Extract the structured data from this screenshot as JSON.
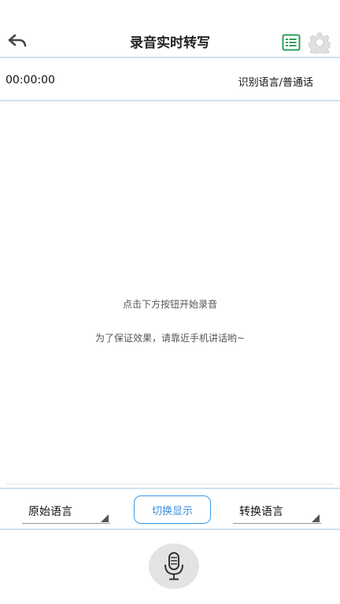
{
  "header": {
    "title": "录音实时转写",
    "back_icon": "back-arrow-icon",
    "list_icon": "list-icon",
    "settings_icon": "gear-icon"
  },
  "status": {
    "timer": "00:00:00",
    "recognition_language": "识别语言/普通话"
  },
  "main": {
    "hint_line1": "点击下方按钮开始录音",
    "hint_line2": "为了保证效果，请靠近手机讲话哟~"
  },
  "language_bar": {
    "source_language": "原始语言",
    "switch_display": "切换显示",
    "target_language": "转换语言"
  },
  "record": {
    "mic_icon": "microphone-icon"
  },
  "colors": {
    "accent": "#3a9be8",
    "divider": "#cfe3f2",
    "list_icon_green": "#2e9e5b"
  }
}
